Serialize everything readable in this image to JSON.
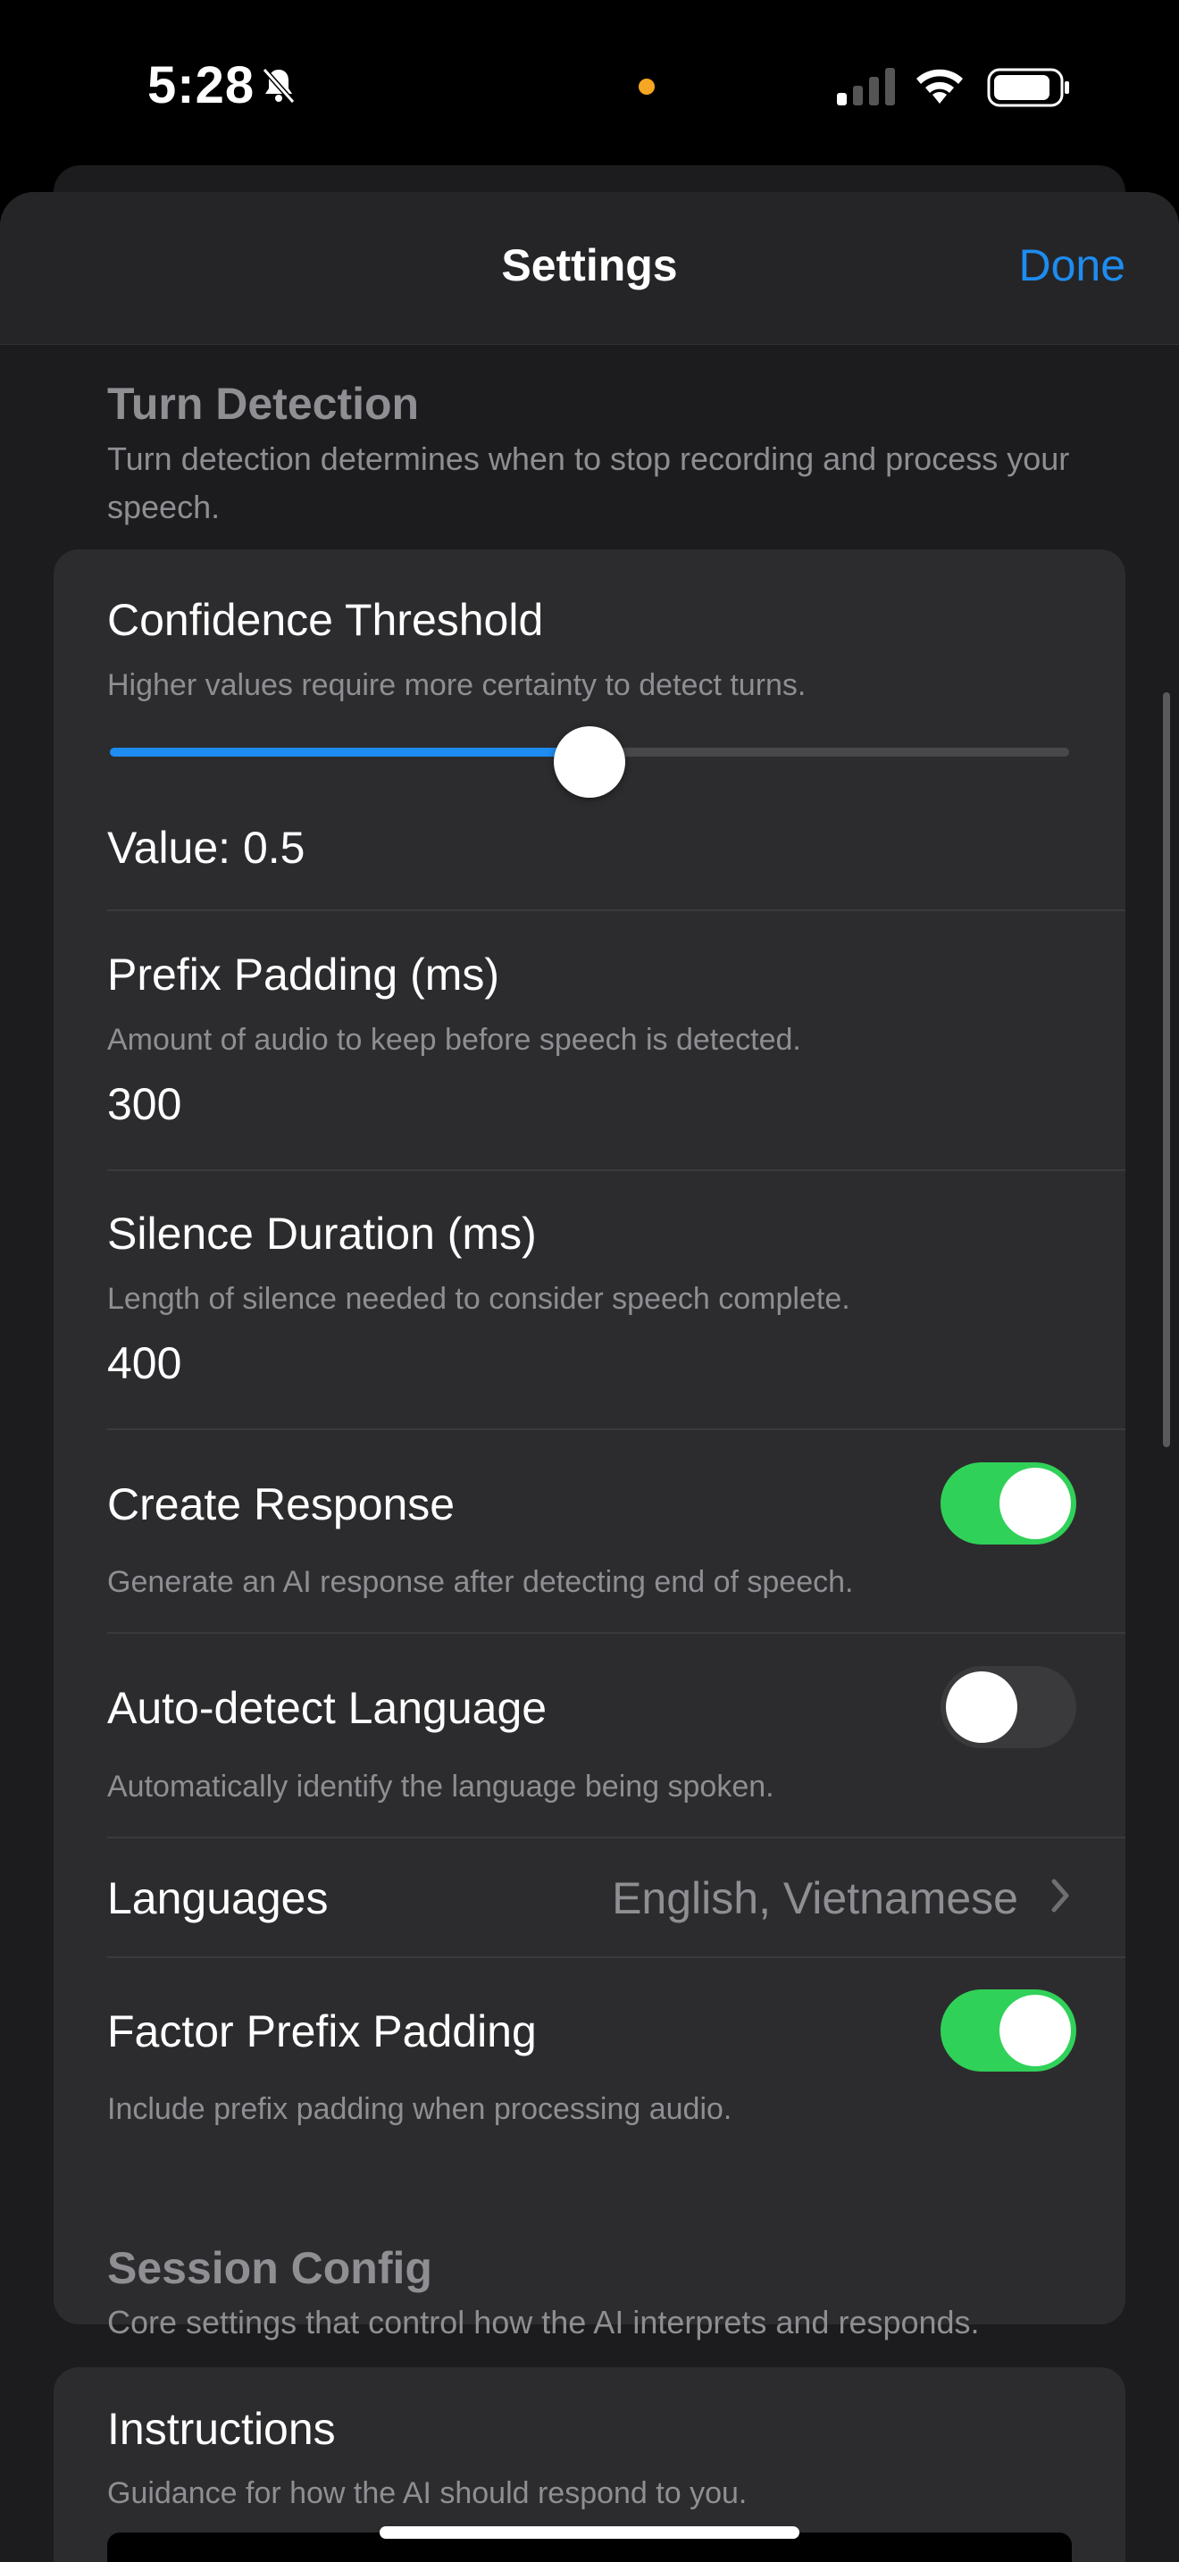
{
  "status_bar": {
    "time": "5:28",
    "battery_level": 0.85,
    "accent_dot_color": "#f5a623"
  },
  "nav": {
    "title": "Settings",
    "done_label": "Done"
  },
  "turn_detection": {
    "header": "Turn Detection",
    "description": "Turn detection determines when to stop recording and process your speech.",
    "confidence": {
      "title": "Confidence Threshold",
      "description": "Higher values require more certainty to detect turns.",
      "value_label": "Value: 0.5",
      "value": 0.5
    },
    "prefix_padding": {
      "title": "Prefix Padding (ms)",
      "description": "Amount of audio to keep before speech is detected.",
      "value": "300"
    },
    "silence_duration": {
      "title": "Silence Duration (ms)",
      "description": "Length of silence needed to consider speech complete.",
      "value": "400"
    },
    "create_response": {
      "title": "Create Response",
      "description": "Generate an AI response after detecting end of speech.",
      "enabled": true
    },
    "auto_detect_language": {
      "title": "Auto-detect Language",
      "description": "Automatically identify the language being spoken.",
      "enabled": false
    },
    "languages": {
      "title": "Languages",
      "value": "English, Vietnamese"
    },
    "factor_prefix_padding": {
      "title": "Factor Prefix Padding",
      "description": "Include prefix padding when processing audio.",
      "enabled": true
    }
  },
  "session_config": {
    "header": "Session Config",
    "description": "Core settings that control how the AI interprets and responds.",
    "instructions": {
      "title": "Instructions",
      "description": "Guidance for how the AI should respond to you."
    }
  },
  "colors": {
    "accent": "#1e8cf0",
    "toggle_on": "#30d158"
  }
}
